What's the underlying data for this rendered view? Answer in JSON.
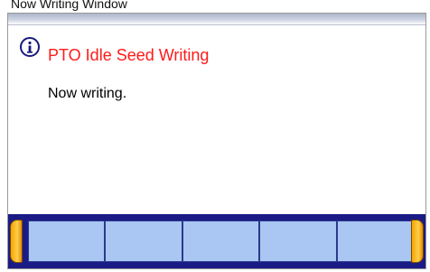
{
  "window": {
    "caption": "Now Writing Window",
    "title": "PTO Idle Seed Writing",
    "message": "Now writing.",
    "icon": "info-icon"
  },
  "function_keys": [
    "",
    "",
    "",
    "",
    ""
  ],
  "colors": {
    "title_red": "#ff1a1a",
    "button_bar": "#1b1b86",
    "button_fill": "#a9c7f2",
    "tab_orange": "#f5a400"
  }
}
